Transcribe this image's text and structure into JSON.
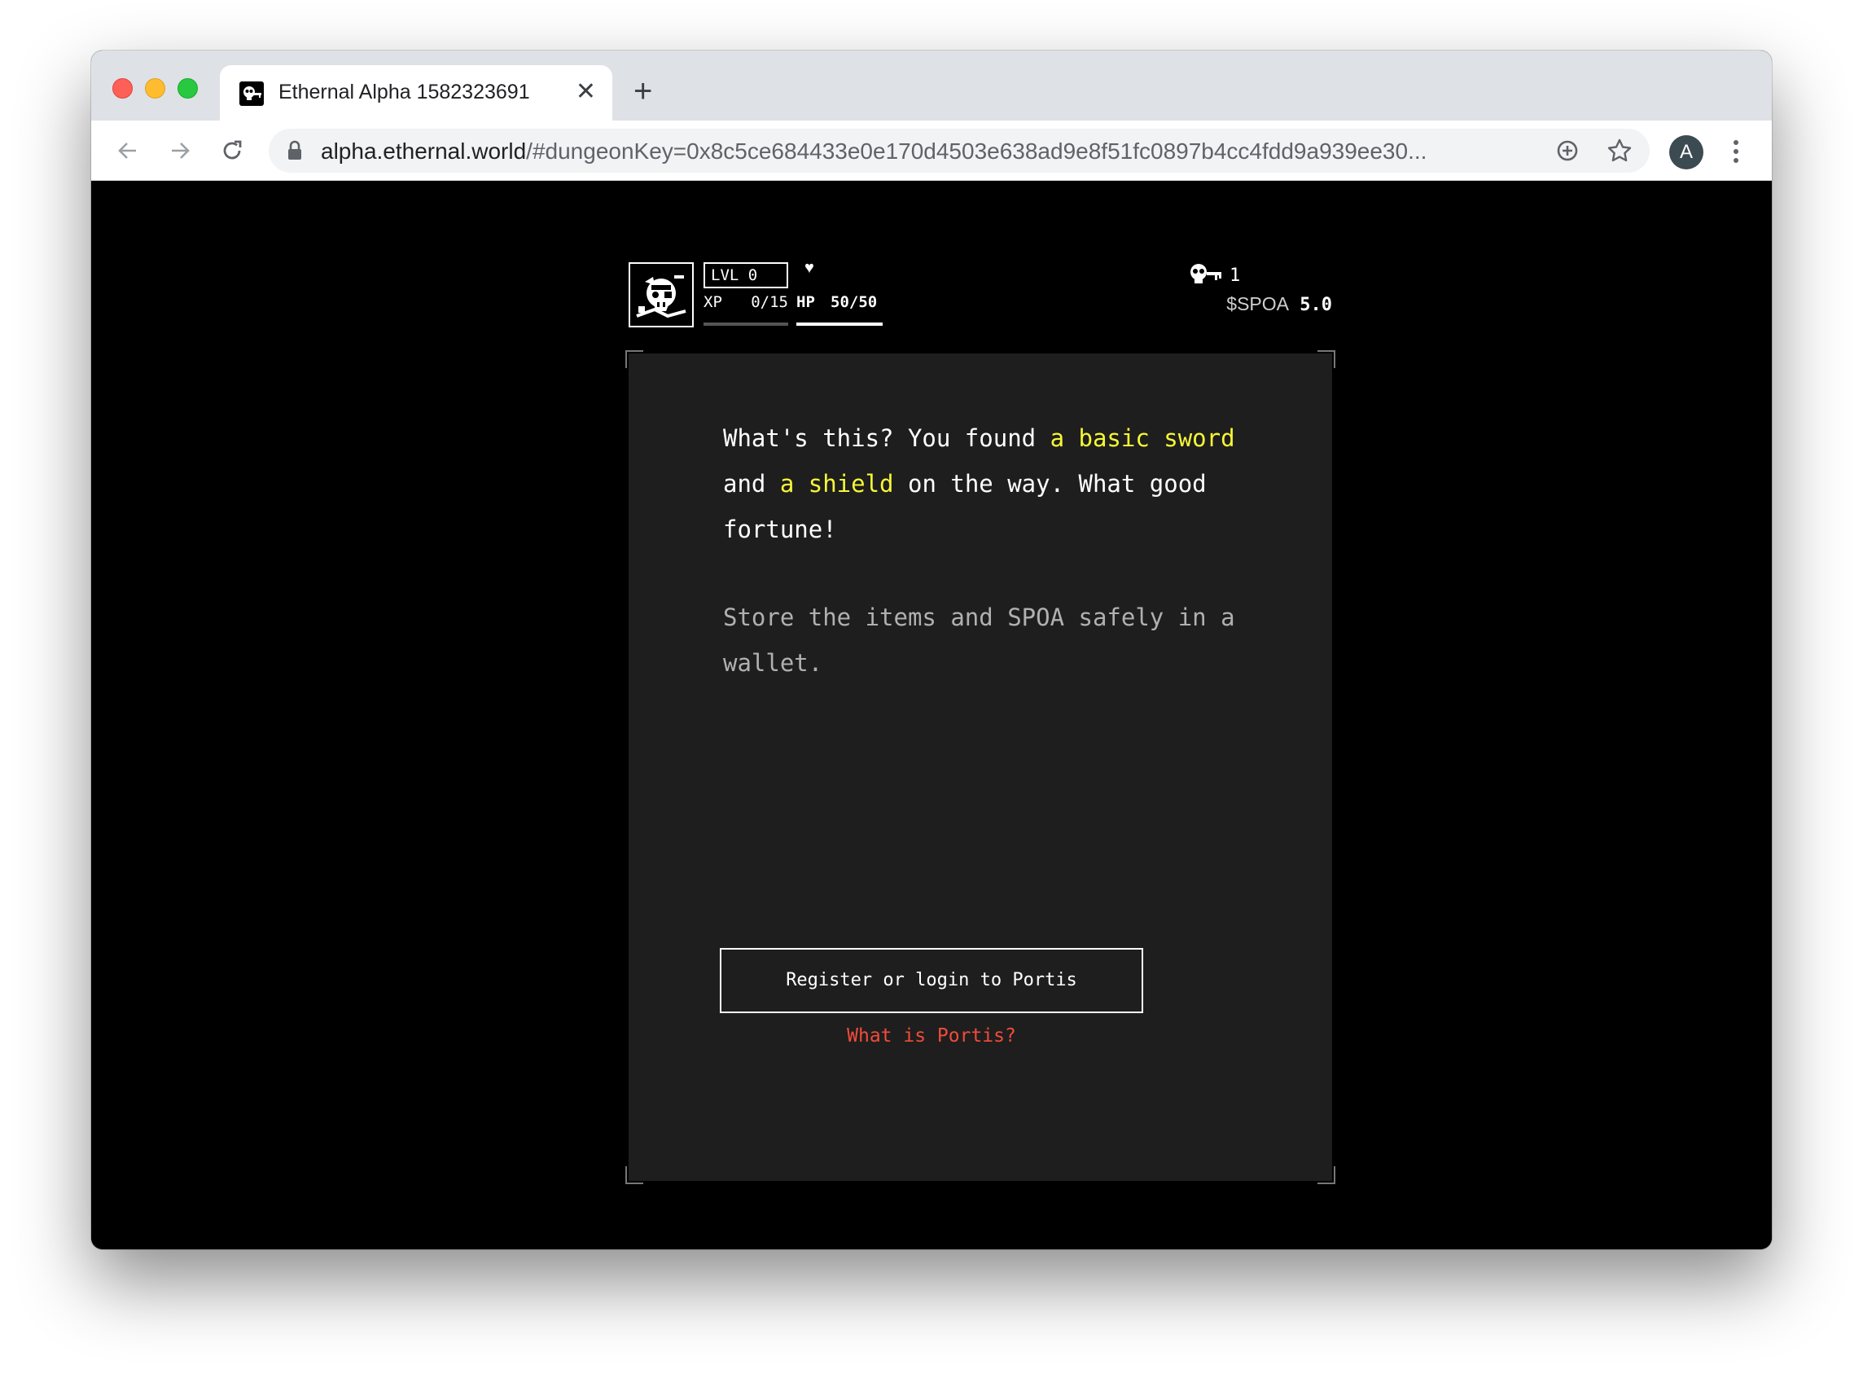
{
  "browser": {
    "tab": {
      "title": "Ethernal Alpha 1582323691",
      "close_label": "✕"
    },
    "newtab_label": "+",
    "url_host": "alpha.ethernal.world",
    "url_rest": "/#dungeonKey=0x8c5ce684433e0e170d4503e638ad9e8f51fc0897b4cc4fdd9a939ee30...",
    "avatar_initial": "A",
    "icons": [
      "back-icon",
      "forward-icon",
      "reload-icon",
      "lock-icon",
      "add-icon",
      "star-icon",
      "menu-icon"
    ]
  },
  "hud": {
    "level_text": "LVL 0",
    "heart": "♥",
    "xp_label": "XP",
    "xp_value": "0/15",
    "hp_label": "HP",
    "hp_value": "50/50",
    "key_count": "1",
    "spoa_label": "$SPOA",
    "spoa_value": "5.0"
  },
  "dialog": {
    "story": {
      "p1": "What's this? You found ",
      "item1": "a basic sword",
      "p2": " and ",
      "item2": "a shield",
      "p3": " on the way. What good fortune!"
    },
    "hint": "Store the items and SPOA safely in a wallet.",
    "register_button": "Register or login to Portis",
    "portis_link": "What is Portis?"
  },
  "colors": {
    "highlight": "#f7f736",
    "link": "#f24b3a",
    "card_bg": "#1e1e1e"
  }
}
